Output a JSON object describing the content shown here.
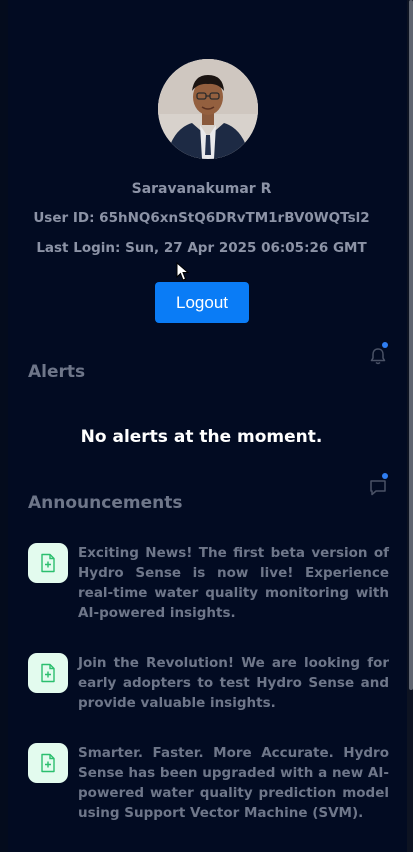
{
  "profile": {
    "name": "Saravanakumar R",
    "user_id": "User ID: 65hNQ6xnStQ6DRvTM1rBV0WQTsl2",
    "last_login": "Last Login: Sun, 27 Apr 2025 06:05:26 GMT",
    "logout_label": "Logout"
  },
  "alerts": {
    "title": "Alerts",
    "empty_message": "No alerts at the moment.",
    "bell_icon": "bell-icon",
    "has_notification": true
  },
  "announcements": {
    "title": "Announcements",
    "chat_icon": "chat-icon",
    "has_notification": true,
    "items": [
      {
        "icon": "file-plus-icon",
        "text": "Exciting News! The first beta version of Hydro Sense is now live! Experience real-time water quality monitoring with AI-powered insights."
      },
      {
        "icon": "file-plus-icon",
        "text": "Join the Revolution! We are looking for early adopters to test Hydro Sense and provide valuable insights."
      },
      {
        "icon": "file-plus-icon",
        "text": "Smarter. Faster. More Accurate. Hydro Sense has been upgraded with a new AI-powered water quality prediction model using Support Vector Machine (SVM)."
      }
    ]
  },
  "colors": {
    "background": "#020b22",
    "accent": "#0a7cf6",
    "icon_bg": "#e3fbee",
    "icon_fg": "#2bbf6e",
    "notification_dot": "#2f7ef3",
    "muted_text": "#6e7689"
  }
}
